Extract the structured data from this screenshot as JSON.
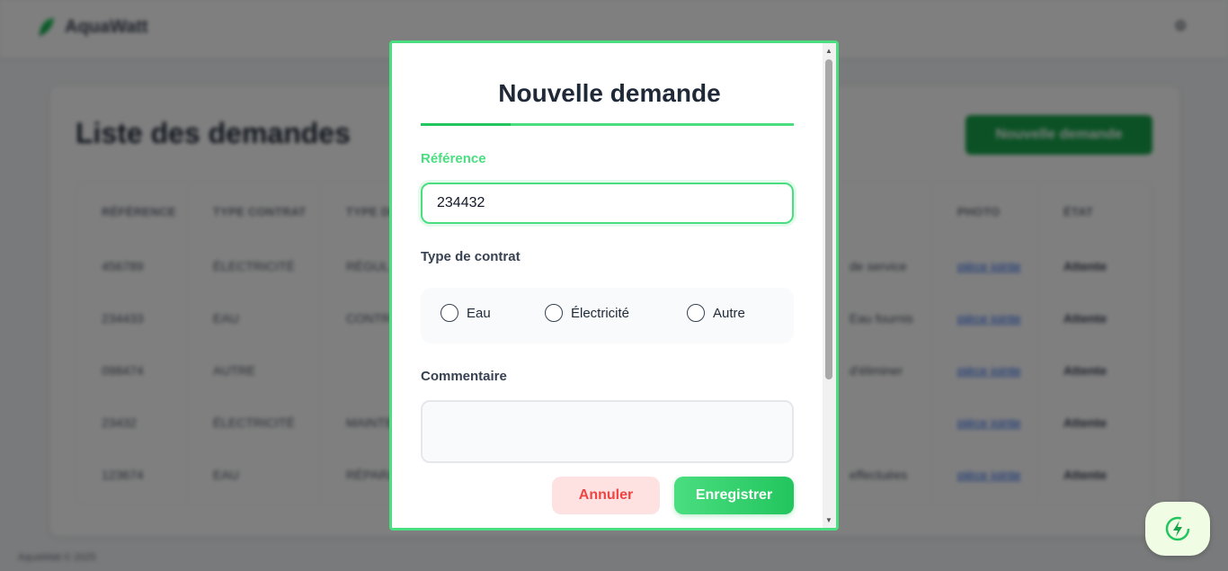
{
  "app": {
    "name": "AquaWatt"
  },
  "page": {
    "title": "Liste des demandes",
    "new_button": "Nouvelle demande",
    "footer": "AquaWatt © 2025"
  },
  "table": {
    "headers": [
      "RÉFÉRENCE",
      "TYPE CONTRAT",
      "TYPE DE",
      "",
      "PHOTO",
      "ÉTAT"
    ],
    "rows": [
      [
        "456789",
        "ÉLECTRICITÉ",
        "RÉGUL",
        "de service",
        "pièce jointe",
        "Attente"
      ],
      [
        "234433",
        "EAU",
        "CONTR",
        "Eau fournis",
        "pièce jointe",
        "Attente"
      ],
      [
        "098474",
        "AUTRE",
        "",
        "d'éliminer",
        "pièce jointe",
        "Attente"
      ],
      [
        "23432",
        "ÉLECTRICITÉ",
        "MAINTE",
        "",
        "pièce jointe",
        "Attente"
      ],
      [
        "123674",
        "EAU",
        "RÉPARA",
        "effectuées",
        "pièce jointe",
        "Attente"
      ]
    ]
  },
  "modal": {
    "title": "Nouvelle demande",
    "reference_label": "Référence",
    "reference_value": "234432",
    "contract_label": "Type de contrat",
    "contract_options": [
      "Eau",
      "Électricité",
      "Autre"
    ],
    "comment_label": "Commentaire",
    "comment_value": "",
    "cancel_label": "Annuler",
    "save_label": "Enregistrer"
  },
  "colors": {
    "accent": "#4ade80",
    "primary_green": "#16a34a",
    "danger": "#ef4444",
    "danger_bg": "#fee2e2"
  },
  "icons": {
    "brand": "leaf-logo-icon",
    "top_right": "settings-icon",
    "fab": "eco-energy-icon"
  }
}
